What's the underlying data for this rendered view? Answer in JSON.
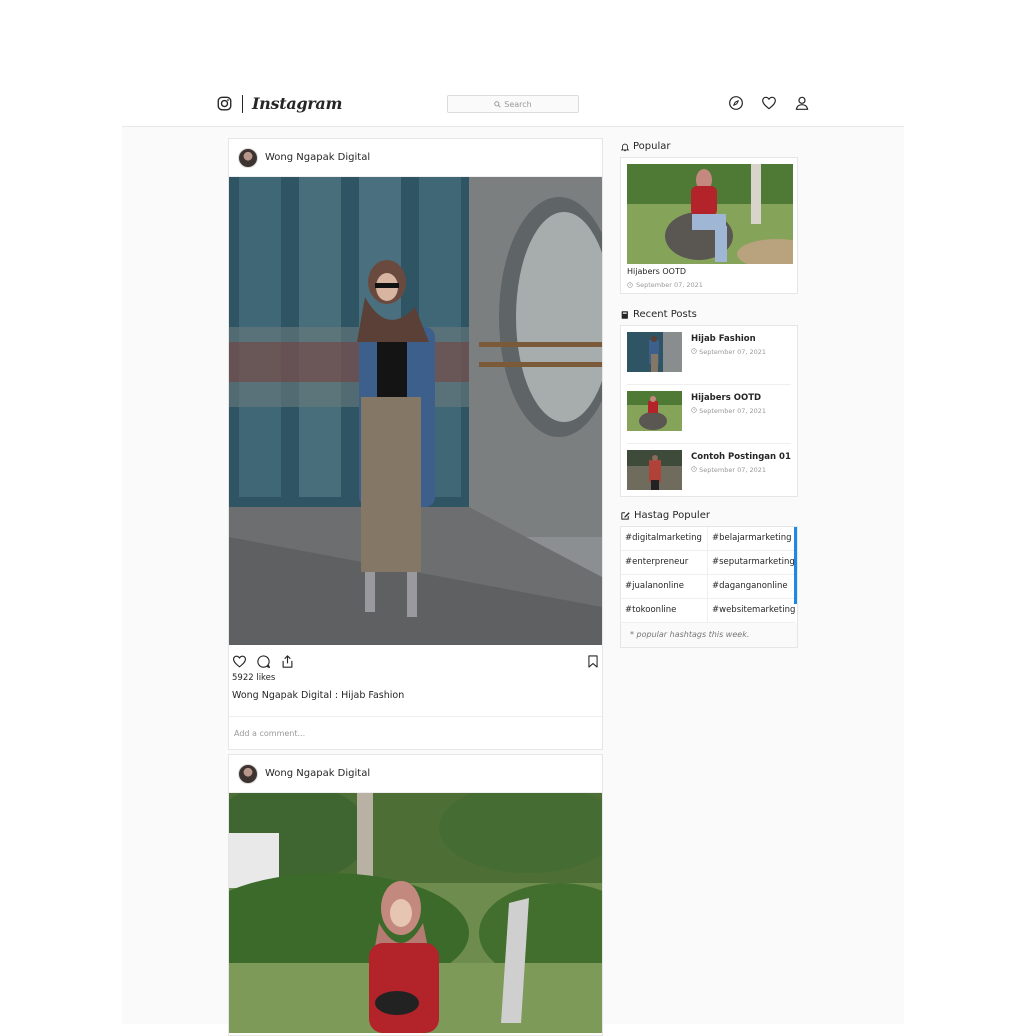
{
  "header": {
    "brand": "Instagram",
    "search_placeholder": "Search",
    "icons": [
      "instagram-glyph-icon",
      "compass-icon",
      "heart-icon",
      "user-icon"
    ]
  },
  "posts": [
    {
      "username": "Wong Ngapak Digital",
      "likes": "5922 likes",
      "caption": "Wong Ngapak Digital : Hijab Fashion",
      "comment_placeholder": "Add a comment..."
    },
    {
      "username": "Wong Ngapak Digital"
    }
  ],
  "sidebar": {
    "popular": {
      "title": "Popular",
      "post_title": "Hijabers OOTD",
      "post_date": "September 07, 2021"
    },
    "recent": {
      "title": "Recent Posts",
      "items": [
        {
          "title": "Hijab Fashion",
          "date": "September 07, 2021"
        },
        {
          "title": "Hijabers OOTD",
          "date": "September 07, 2021"
        },
        {
          "title": "Contoh Postingan 01",
          "date": "September 07, 2021"
        }
      ]
    },
    "hashtags": {
      "title": "Hastag Populer",
      "tags": [
        "#digitalmarketing",
        "#belajarmarketing",
        "#enterpreneur",
        "#seputarmarketing",
        "#jualanonline",
        "#daganganonline",
        "#tokoonline",
        "#websitemarketing"
      ],
      "note": "* popular hashtags this week."
    }
  },
  "colors": {
    "accent": "#1e88e5",
    "border": "#e6e6e6",
    "page_bg": "#fafafa"
  }
}
